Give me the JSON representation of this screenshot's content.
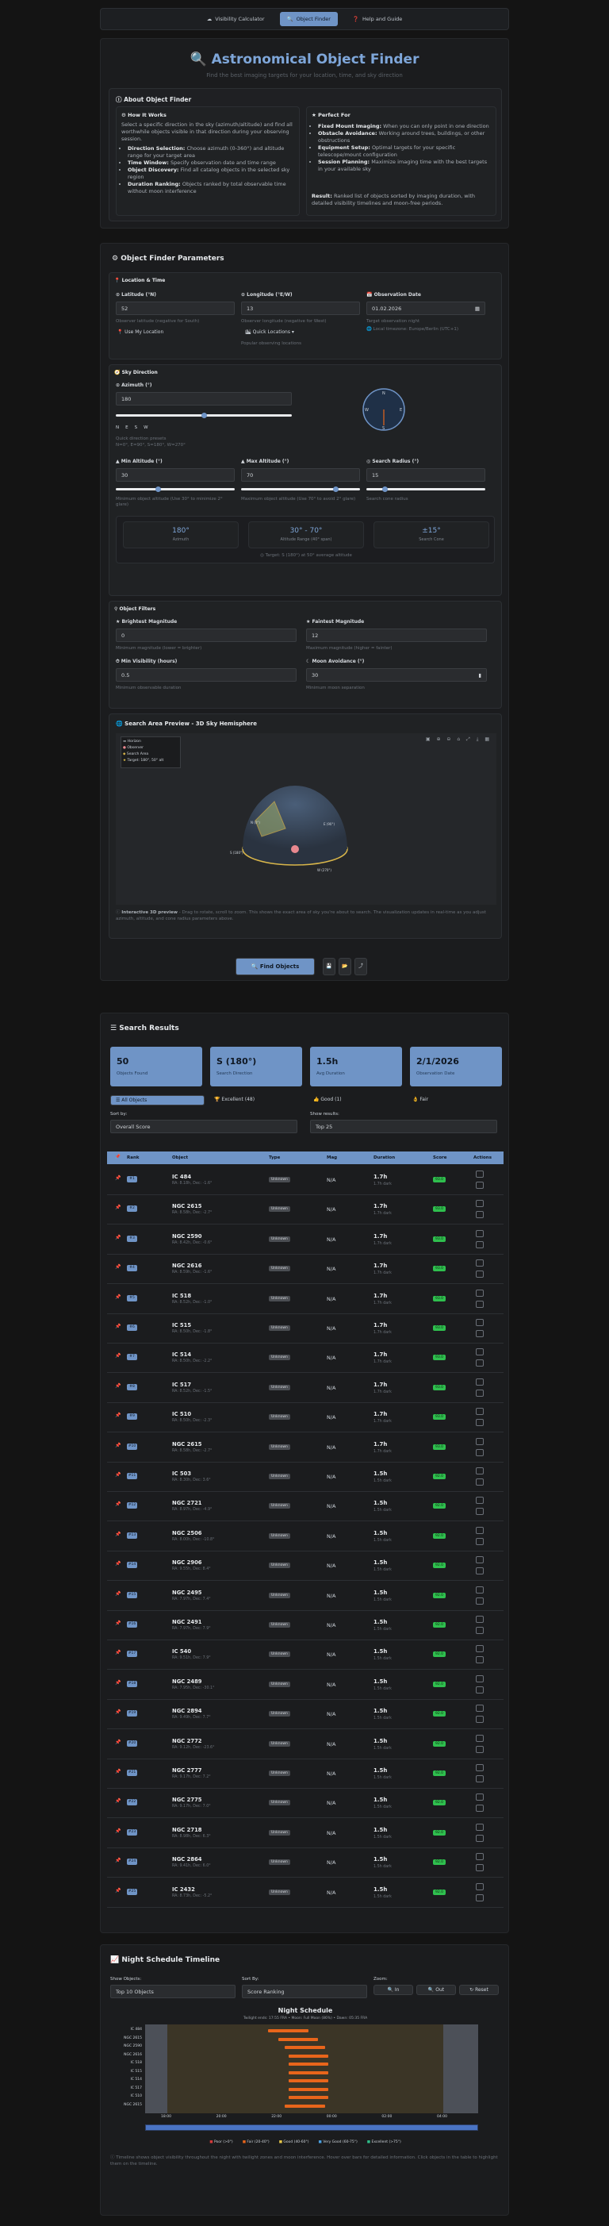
{
  "nav": {
    "items": [
      {
        "icon": "☁",
        "label": "Visibility Calculator"
      },
      {
        "icon": "🔍",
        "label": "Object Finder"
      },
      {
        "icon": "❓",
        "label": "Help and Guide"
      }
    ]
  },
  "header": {
    "title": "Astronomical Object Finder",
    "subtitle": "Find the best imaging targets for your location, time, and sky direction"
  },
  "about": {
    "title": "About Object Finder",
    "how": {
      "title": "How It Works",
      "text": "Select a specific direction in the sky (azimuth/altitude) and find all worthwhile objects visible in that direction during your observing session.",
      "items": [
        {
          "b": "Direction Selection:",
          "t": "Choose azimuth (0-360°) and altitude range for your target area"
        },
        {
          "b": "Time Window:",
          "t": "Specify observation date and time range"
        },
        {
          "b": "Object Discovery:",
          "t": "Find all catalog objects in the selected sky region"
        },
        {
          "b": "Duration Ranking:",
          "t": "Objects ranked by total observable time without moon interference"
        }
      ]
    },
    "perfect": {
      "title": "Perfect For",
      "items": [
        {
          "b": "Fixed Mount Imaging:",
          "t": "When you can only point in one direction"
        },
        {
          "b": "Obstacle Avoidance:",
          "t": "Working around trees, buildings, or other obstructions"
        },
        {
          "b": "Equipment Setup:",
          "t": "Optimal targets for your specific telescope/mount configuration"
        },
        {
          "b": "Session Planning:",
          "t": "Maximize imaging time with the best targets in your available sky"
        }
      ],
      "result_b": "Result:",
      "result": "Ranked list of objects sorted by imaging duration, with detailed visibility timelines and moon-free periods."
    }
  },
  "params": {
    "title": "Object Finder Parameters",
    "loc": {
      "title": "Location & Time",
      "lat_label": "Latitude (°N)",
      "lat": "52",
      "lat_hint": "Observer latitude (negative for South)",
      "use_loc": "Use My Location",
      "lon_label": "Longitude (°E/W)",
      "lon": "13",
      "lon_hint": "Observer longitude (negative for West)",
      "quick": "Quick Locations",
      "quick_hint": "Popular observing locations",
      "date_label": "Observation Date",
      "date": "01.02.2026",
      "date_hint": "Target observation night",
      "tz": "Local timezone: Europe/Berlin (UTC+1)"
    },
    "sky": {
      "title": "Sky Direction",
      "az_label": "Azimuth (°)",
      "az": "180",
      "compass": [
        "N",
        "E",
        "S",
        "W"
      ],
      "az_hint": "Quick direction presets",
      "az_hint2": "N=0°, E=90°, S=180°, W=270°",
      "minalt_label": "Min Altitude (°)",
      "minalt": "30",
      "minalt_hint": "Minimum object altitude (Use 30° to minimize 2° glare)",
      "maxalt_label": "Max Altitude (°)",
      "maxalt": "70",
      "maxalt_hint": "Maximum object altitude (Use 70° to avoid 2° glare)",
      "rad_label": "Search Radius (°)",
      "rad": "15",
      "rad_hint": "Search cone radius",
      "sum1_v": "180°",
      "sum1_l": "Azimuth",
      "sum2_v": "30° - 70°",
      "sum2_l": "Altitude Range (40° span)",
      "sum3_v": "±15°",
      "sum3_l": "Search Cone",
      "target": "Target: S (180°) at 50° average altitude"
    },
    "filters": {
      "title": "Object Filters",
      "bright_label": "Brightest Magnitude",
      "bright": "0",
      "bright_hint": "Minimum magnitude (lower = brighter)",
      "faint_label": "Faintest Magnitude",
      "faint": "12",
      "faint_hint": "Maximum magnitude (higher = fainter)",
      "minvis_label": "Min Visibility (hours)",
      "minvis": "0.5",
      "minvis_hint": "Minimum observable duration",
      "moon_label": "Moon Avoidance (°)",
      "moon": "30",
      "moon_hint": "Minimum moon separation"
    },
    "preview": {
      "title": "Search Area Preview - 3D Sky Hemisphere",
      "legend": [
        "Horizon",
        "Observer",
        "Search Area",
        "Target: 180°, 50° alt"
      ],
      "labels": [
        "N (0°)",
        "E (90°)",
        "S (180°)",
        "W (270°)"
      ],
      "note_b": "Interactive 3D preview",
      "note": "- Drag to rotate, scroll to zoom. This shows the exact area of sky you're about to search. The visualization updates in real-time as you adjust azimuth, altitude, and cone radius parameters above."
    },
    "find_btn": "Find Objects"
  },
  "results": {
    "title": "Search Results",
    "stats": [
      {
        "v": "50",
        "l": "Objects Found"
      },
      {
        "v": "S (180°)",
        "l": "Search Direction"
      },
      {
        "v": "1.5h",
        "l": "Avg Duration"
      },
      {
        "v": "2/1/2026",
        "l": "Observation Date"
      }
    ],
    "tabs": [
      "All Objects",
      "Excellent (48)",
      "Good (1)",
      "Fair"
    ],
    "sort_label": "Sort by:",
    "sort": "Overall Score",
    "show_label": "Show results:",
    "show": "Top 25",
    "cols": [
      "Rank",
      "Object",
      "Type",
      "Mag",
      "Duration",
      "Score",
      "Actions"
    ],
    "rows": [
      {
        "rank": "#1",
        "name": "IC 484",
        "coord": "RA: 8.18h, Dec: -1.6°",
        "type": "Unknown",
        "mag": "N/A",
        "dur": "1.7h",
        "dsub": "1.7h dark",
        "score": "93.0"
      },
      {
        "rank": "#2",
        "name": "NGC 2615",
        "coord": "RA: 8.58h, Dec: -2.7°",
        "type": "Unknown",
        "mag": "N/A",
        "dur": "1.7h",
        "dsub": "1.7h dark",
        "score": "93.0"
      },
      {
        "rank": "#3",
        "name": "NGC 2590",
        "coord": "RA: 8.42h, Dec: -0.6°",
        "type": "Unknown",
        "mag": "N/A",
        "dur": "1.7h",
        "dsub": "1.7h dark",
        "score": "93.0"
      },
      {
        "rank": "#4",
        "name": "NGC 2616",
        "coord": "RA: 8.59h, Dec: -1.6°",
        "type": "Unknown",
        "mag": "N/A",
        "dur": "1.7h",
        "dsub": "1.7h dark",
        "score": "93.0"
      },
      {
        "rank": "#5",
        "name": "IC 518",
        "coord": "RA: 8.52h, Dec: -1.0°",
        "type": "Unknown",
        "mag": "N/A",
        "dur": "1.7h",
        "dsub": "1.7h dark",
        "score": "93.0"
      },
      {
        "rank": "#6",
        "name": "IC 515",
        "coord": "RA: 8.50h, Dec: -1.8°",
        "type": "Unknown",
        "mag": "N/A",
        "dur": "1.7h",
        "dsub": "1.7h dark",
        "score": "93.0"
      },
      {
        "rank": "#7",
        "name": "IC 514",
        "coord": "RA: 8.50h, Dec: -2.2°",
        "type": "Unknown",
        "mag": "N/A",
        "dur": "1.7h",
        "dsub": "1.7h dark",
        "score": "93.0"
      },
      {
        "rank": "#8",
        "name": "IC 517",
        "coord": "RA: 8.52h, Dec: -1.5°",
        "type": "Unknown",
        "mag": "N/A",
        "dur": "1.7h",
        "dsub": "1.7h dark",
        "score": "93.0"
      },
      {
        "rank": "#9",
        "name": "IC 510",
        "coord": "RA: 8.50h, Dec: -2.3°",
        "type": "Unknown",
        "mag": "N/A",
        "dur": "1.7h",
        "dsub": "1.7h dark",
        "score": "93.0"
      },
      {
        "rank": "#10",
        "name": "NGC 2615",
        "coord": "RA: 8.58h, Dec: -2.7°",
        "type": "Unknown",
        "mag": "N/A",
        "dur": "1.7h",
        "dsub": "1.7h dark",
        "score": "93.0"
      },
      {
        "rank": "#11",
        "name": "IC 503",
        "coord": "RA: 8.30h, Dec: 3.6°",
        "type": "Unknown",
        "mag": "N/A",
        "dur": "1.5h",
        "dsub": "1.5h dark",
        "score": "92.0"
      },
      {
        "rank": "#12",
        "name": "NGC 2721",
        "coord": "RA: 8.97h, Dec: -4.9°",
        "type": "Unknown",
        "mag": "N/A",
        "dur": "1.5h",
        "dsub": "1.5h dark",
        "score": "92.0"
      },
      {
        "rank": "#13",
        "name": "NGC 2506",
        "coord": "RA: 8.00h, Dec: -10.8°",
        "type": "Unknown",
        "mag": "N/A",
        "dur": "1.5h",
        "dsub": "1.5h dark",
        "score": "92.0"
      },
      {
        "rank": "#14",
        "name": "NGC 2906",
        "coord": "RA: 9.55h, Dec: 8.4°",
        "type": "Unknown",
        "mag": "N/A",
        "dur": "1.5h",
        "dsub": "1.5h dark",
        "score": "92.0"
      },
      {
        "rank": "#15",
        "name": "NGC 2495",
        "coord": "RA: 7.97h, Dec: 7.4°",
        "type": "Unknown",
        "mag": "N/A",
        "dur": "1.5h",
        "dsub": "1.5h dark",
        "score": "92.0"
      },
      {
        "rank": "#16",
        "name": "NGC 2491",
        "coord": "RA: 7.97h, Dec: 7.9°",
        "type": "Unknown",
        "mag": "N/A",
        "dur": "1.5h",
        "dsub": "1.5h dark",
        "score": "92.0"
      },
      {
        "rank": "#17",
        "name": "IC 540",
        "coord": "RA: 9.51h, Dec: 7.9°",
        "type": "Unknown",
        "mag": "N/A",
        "dur": "1.5h",
        "dsub": "1.5h dark",
        "score": "92.0"
      },
      {
        "rank": "#18",
        "name": "NGC 2489",
        "coord": "RA: 7.95h, Dec: -30.1°",
        "type": "Unknown",
        "mag": "N/A",
        "dur": "1.5h",
        "dsub": "1.5h dark",
        "score": "92.0"
      },
      {
        "rank": "#19",
        "name": "NGC 2894",
        "coord": "RA: 9.49h, Dec: 7.7°",
        "type": "Unknown",
        "mag": "N/A",
        "dur": "1.5h",
        "dsub": "1.5h dark",
        "score": "92.0"
      },
      {
        "rank": "#20",
        "name": "NGC 2772",
        "coord": "RA: 9.12h, Dec: -23.6°",
        "type": "Unknown",
        "mag": "N/A",
        "dur": "1.5h",
        "dsub": "1.5h dark",
        "score": "92.0"
      },
      {
        "rank": "#21",
        "name": "NGC 2777",
        "coord": "RA: 9.17h, Dec: 7.2°",
        "type": "Unknown",
        "mag": "N/A",
        "dur": "1.5h",
        "dsub": "1.5h dark",
        "score": "92.0"
      },
      {
        "rank": "#22",
        "name": "NGC 2775",
        "coord": "RA: 9.17h, Dec: 7.0°",
        "type": "Unknown",
        "mag": "N/A",
        "dur": "1.5h",
        "dsub": "1.5h dark",
        "score": "92.0"
      },
      {
        "rank": "#23",
        "name": "NGC 2718",
        "coord": "RA: 8.98h, Dec: 6.3°",
        "type": "Unknown",
        "mag": "N/A",
        "dur": "1.5h",
        "dsub": "1.5h dark",
        "score": "92.0"
      },
      {
        "rank": "#24",
        "name": "NGC 2864",
        "coord": "RA: 9.41h, Dec: 6.0°",
        "type": "Unknown",
        "mag": "N/A",
        "dur": "1.5h",
        "dsub": "1.5h dark",
        "score": "92.0"
      },
      {
        "rank": "#25",
        "name": "IC 2432",
        "coord": "RA: 8.73h, Dec: -5.2°",
        "type": "Unknown",
        "mag": "N/A",
        "dur": "1.5h",
        "dsub": "1.5h dark",
        "score": "92.0"
      }
    ]
  },
  "timeline": {
    "title": "Night Schedule Timeline",
    "show_label": "Show Objects:",
    "show": "Top 10 Objects",
    "sort_label": "Sort By:",
    "sort": "Score Ranking",
    "zoom_label": "Zoom:",
    "zoom": [
      "In",
      "Out",
      "Reset"
    ],
    "chart_title": "Night Schedule",
    "chart_sub": "Twilight ends: 17:55 FRA  •  Moon: Full Moon (86%)  •  Dawn: 05:35 FRA",
    "objects": [
      "IC 484",
      "NGC 2615",
      "NGC 2590",
      "NGC 2616",
      "IC 518",
      "IC 515",
      "IC 514",
      "IC 517",
      "IC 510",
      "NGC 2615"
    ],
    "legend": [
      "Poor (>0°)",
      "Fair (20-40°)",
      "Good (40-60°)",
      "Very Good (60-75°)",
      "Excellent (>75°)"
    ],
    "ticks": [
      "18:00",
      "20:00",
      "22:00",
      "00:00",
      "02:00",
      "04:00"
    ],
    "note": "Timeline shows object visibility throughout the night with twilight zones and moon interference. Hover over bars for detailed information. Click objects in the table to highlight them on the timeline."
  },
  "colors": {
    "accent": "#6f94c6",
    "score": "#2fbf4e",
    "bar": "#e8651b"
  }
}
